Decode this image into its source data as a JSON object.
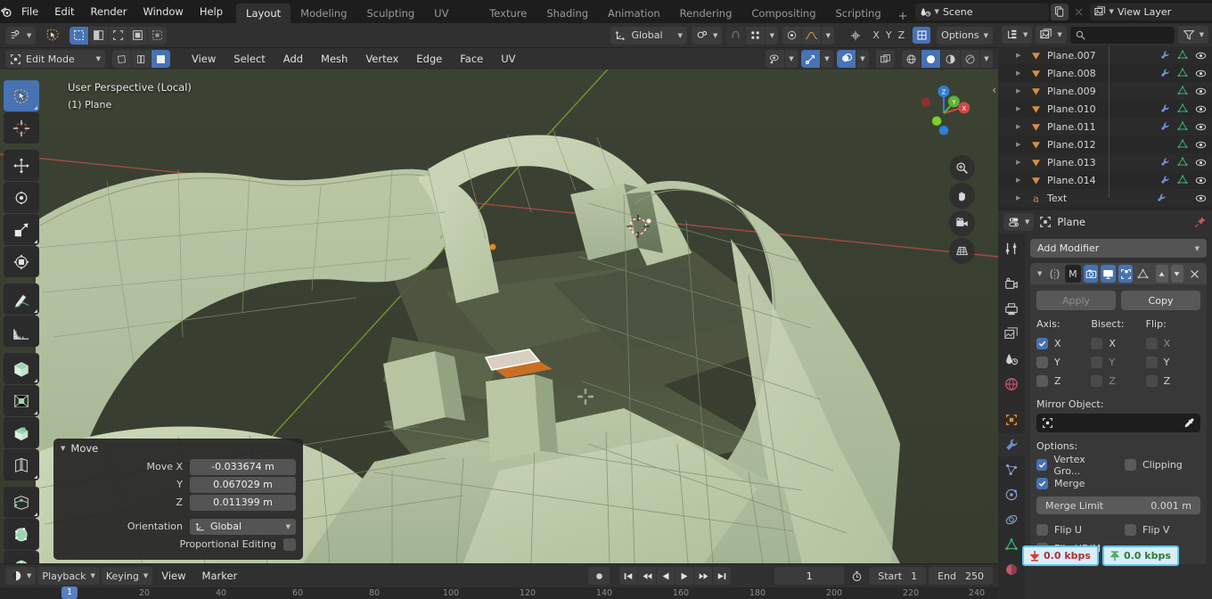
{
  "app": {
    "title": "Blender"
  },
  "topbar": {
    "menus": [
      "File",
      "Edit",
      "Render",
      "Window",
      "Help"
    ],
    "workspace_tabs": [
      {
        "label": "Layout",
        "active": true
      },
      {
        "label": "Modeling",
        "active": false
      },
      {
        "label": "Sculpting",
        "active": false
      },
      {
        "label": "UV Editing",
        "active": false
      },
      {
        "label": "Texture Paint",
        "active": false
      },
      {
        "label": "Shading",
        "active": false
      },
      {
        "label": "Animation",
        "active": false
      },
      {
        "label": "Rendering",
        "active": false
      },
      {
        "label": "Compositing",
        "active": false
      },
      {
        "label": "Scripting",
        "active": false
      }
    ],
    "add_tab_label": "+",
    "scene_name": "Scene",
    "view_layer_name": "View Layer"
  },
  "viewport_header": {
    "transform_orientation": "Global",
    "mode": "Edit Mode",
    "menus": [
      "View",
      "Select",
      "Add",
      "Mesh",
      "Vertex",
      "Edge",
      "Face",
      "UV"
    ]
  },
  "viewport": {
    "perspective_label": "User Perspective (Local)",
    "object_label": "(1) Plane",
    "gizmo_axes": [
      "X",
      "Y",
      "Z"
    ],
    "bg_color": "#3a4030",
    "mesh_color": "#c3cfae"
  },
  "operator_panel": {
    "title": "Move",
    "rows": [
      {
        "label": "Move X",
        "value": "-0.033674 m"
      },
      {
        "label": "Y",
        "value": "0.067029 m"
      },
      {
        "label": "Z",
        "value": "0.011399 m"
      }
    ],
    "orientation_label": "Orientation",
    "orientation_value": "Global",
    "proportional_label": "Proportional Editing",
    "proportional_checked": false
  },
  "timeline": {
    "menus": [
      "Playback",
      "Keying",
      "View",
      "Marker"
    ],
    "current_frame": "1",
    "start_label": "Start",
    "start_value": "1",
    "end_label": "End",
    "end_value": "250",
    "ruler_ticks": [
      "1",
      "20",
      "40",
      "60",
      "80",
      "100",
      "120",
      "140",
      "160",
      "180",
      "200",
      "220",
      "240"
    ]
  },
  "outliner": {
    "search_placeholder": "",
    "rows": [
      {
        "name": "Plane.007",
        "has_wrench": true,
        "has_mesh": true,
        "type": "mesh"
      },
      {
        "name": "Plane.008",
        "has_wrench": true,
        "has_mesh": true,
        "type": "mesh"
      },
      {
        "name": "Plane.009",
        "has_wrench": false,
        "has_mesh": true,
        "type": "mesh"
      },
      {
        "name": "Plane.010",
        "has_wrench": true,
        "has_mesh": true,
        "type": "mesh"
      },
      {
        "name": "Plane.011",
        "has_wrench": true,
        "has_mesh": true,
        "type": "mesh"
      },
      {
        "name": "Plane.012",
        "has_wrench": false,
        "has_mesh": true,
        "type": "mesh"
      },
      {
        "name": "Plane.013",
        "has_wrench": true,
        "has_mesh": true,
        "type": "mesh"
      },
      {
        "name": "Plane.014",
        "has_wrench": true,
        "has_mesh": true,
        "type": "mesh"
      },
      {
        "name": "Text",
        "has_wrench": true,
        "has_mesh": false,
        "type": "text"
      }
    ]
  },
  "properties": {
    "breadcrumb_object": "Plane",
    "add_modifier_label": "Add Modifier",
    "modifier": {
      "type_letter": "M",
      "apply_label": "Apply",
      "copy_label": "Copy",
      "axis_header": "Axis:",
      "bisect_header": "Bisect:",
      "flip_header": "Flip:",
      "axis": [
        {
          "label": "X",
          "checked": true
        },
        {
          "label": "Y",
          "checked": false
        },
        {
          "label": "Z",
          "checked": false
        }
      ],
      "bisect": [
        {
          "label": "X",
          "checked": false
        },
        {
          "label": "Y",
          "checked": false
        },
        {
          "label": "Z",
          "checked": false
        }
      ],
      "flip": [
        {
          "label": "X",
          "checked": false
        },
        {
          "label": "Y",
          "checked": false
        },
        {
          "label": "Z",
          "checked": false
        }
      ],
      "mirror_object_label": "Mirror Object:",
      "mirror_object_value": "",
      "options_label": "Options:",
      "vertex_groups_label": "Vertex Gro...",
      "vertex_groups_checked": true,
      "clipping_label": "Clipping",
      "clipping_checked": false,
      "merge_label": "Merge",
      "merge_checked": true,
      "merge_limit_label": "Merge Limit",
      "merge_limit_value": "0.001 m",
      "flip_u_label": "Flip U",
      "flip_v_label": "Flip V",
      "flip_udim_label": "Flip UDIM",
      "flip_udim_checked": false
    }
  },
  "network_overlay": {
    "download": "0.0 kbps",
    "upload": "0.0 kbps",
    "border_color": "#5ec6f0",
    "bg_color": "#d9eef8",
    "download_color": "#b03030",
    "upload_color": "#2f7a3f"
  }
}
